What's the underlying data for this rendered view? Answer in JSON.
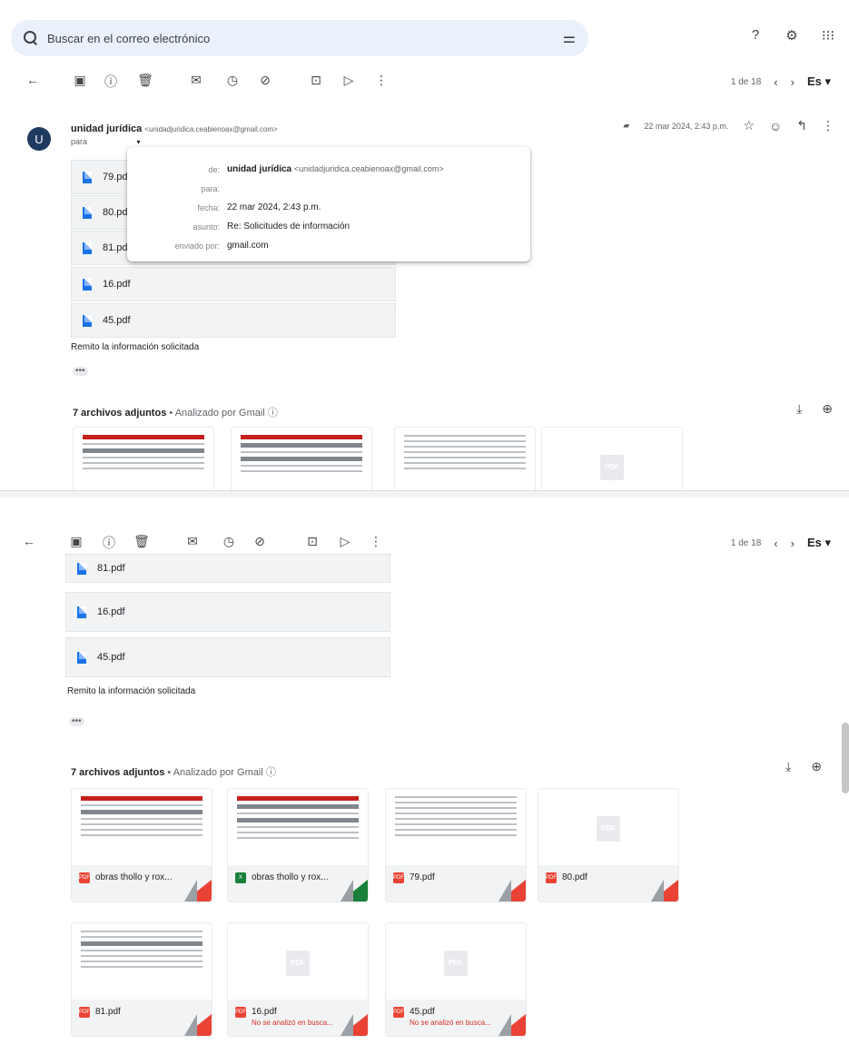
{
  "search": {
    "placeholder": "Buscar en el correo electrónico"
  },
  "toolbar": {
    "pager1": "1 de 18",
    "pager2": "1 de 18",
    "lang": "Es"
  },
  "message": {
    "avatar_letter": "U",
    "sender_name": "unidad jurídica",
    "sender_email": "<unidadjuridica.ceabienoax@gmail.com>",
    "to_label": "para",
    "date_short": "22 mar 2024, 2:43 p.m.",
    "body": "Remito la información solicitada",
    "dots": "•••"
  },
  "popup": {
    "de_label": "de:",
    "de_name": "unidad jurídica",
    "de_email": "<unidadjuridica.ceabienoax@gmail.com>",
    "para_label": "para:",
    "para_value": "",
    "fecha_label": "fecha:",
    "fecha_value": "22 mar 2024, 2:43 p.m.",
    "asunto_label": "asunto:",
    "asunto_value": "Re: Solicitudes de información",
    "enviado_label": "enviado por:",
    "enviado_value": "gmail.com"
  },
  "files_top": [
    "79.pdf",
    "80.pdf",
    "81.pdf",
    "16.pdf",
    "45.pdf"
  ],
  "files_bottom": [
    "81.pdf",
    "16.pdf",
    "45.pdf"
  ],
  "attachments": {
    "count_label": "7 archivos adjuntos",
    "separator": "•",
    "scanned": "Analizado por Gmail",
    "items": [
      {
        "name": "obras thollo y rox...",
        "type": "pdf"
      },
      {
        "name": "obras thollo y rox...",
        "type": "xls"
      },
      {
        "name": "79.pdf",
        "type": "pdf"
      },
      {
        "name": "80.pdf",
        "type": "pdf"
      },
      {
        "name": "81.pdf",
        "type": "pdf"
      },
      {
        "name": "16.pdf",
        "type": "pdf",
        "warning": "No se analizó en busca..."
      },
      {
        "name": "45.pdf",
        "type": "pdf",
        "warning": "No se analizó en busca..."
      }
    ]
  },
  "colors": {
    "avatar": "#1f3a5f",
    "pdf": "#ea4335",
    "xls": "#188038",
    "search_bg": "#eaf1fb"
  }
}
